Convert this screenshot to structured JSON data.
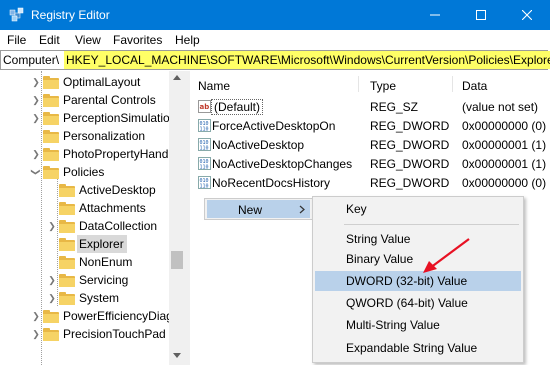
{
  "window": {
    "title": "Registry Editor"
  },
  "menubar": {
    "items": [
      "File",
      "Edit",
      "View",
      "Favorites",
      "Help"
    ]
  },
  "address": {
    "prefix": "Computer\\",
    "path": "HKEY_LOCAL_MACHINE\\SOFTWARE\\Microsoft\\Windows\\CurrentVersion\\Policies\\Explorer"
  },
  "tree": {
    "items": [
      {
        "label": "OptimalLayout"
      },
      {
        "label": "Parental Controls"
      },
      {
        "label": "PerceptionSimulatio"
      },
      {
        "label": "Personalization"
      },
      {
        "label": "PhotoPropertyHandl"
      },
      {
        "label": "Policies"
      },
      {
        "label": "ActiveDesktop"
      },
      {
        "label": "Attachments"
      },
      {
        "label": "DataCollection"
      },
      {
        "label": "Explorer"
      },
      {
        "label": "NonEnum"
      },
      {
        "label": "Servicing"
      },
      {
        "label": "System"
      },
      {
        "label": "PowerEfficiencyDiag"
      },
      {
        "label": "PrecisionTouchPad"
      }
    ]
  },
  "list": {
    "columns": {
      "name": "Name",
      "type": "Type",
      "data": "Data"
    },
    "rows": [
      {
        "name": "(Default)",
        "type": "REG_SZ",
        "data": "(value not set)",
        "icon": "string-value-icon"
      },
      {
        "name": "ForceActiveDesktopOn",
        "type": "REG_DWORD",
        "data": "0x00000000 (0)",
        "icon": "binary-value-icon"
      },
      {
        "name": "NoActiveDesktop",
        "type": "REG_DWORD",
        "data": "0x00000001 (1)",
        "icon": "binary-value-icon"
      },
      {
        "name": "NoActiveDesktopChanges",
        "type": "REG_DWORD",
        "data": "0x00000001 (1)",
        "icon": "binary-value-icon"
      },
      {
        "name": "NoRecentDocsHistory",
        "type": "REG_DWORD",
        "data": "0x00000000 (0)",
        "icon": "binary-value-icon"
      }
    ]
  },
  "context_menu": {
    "new_label": "New",
    "submenu": {
      "key": "Key",
      "string_value": "String Value",
      "binary_value": "Binary Value",
      "dword_value": "DWORD (32-bit) Value",
      "qword_value": "QWORD (64-bit) Value",
      "multi_string_value": "Multi-String Value",
      "expandable_string_value": "Expandable String Value"
    }
  },
  "colors": {
    "titlebar": "#0078d7",
    "address_highlight": "#ffff66",
    "menu_highlight": "#b9d1ea",
    "arrow": "#e81123"
  }
}
